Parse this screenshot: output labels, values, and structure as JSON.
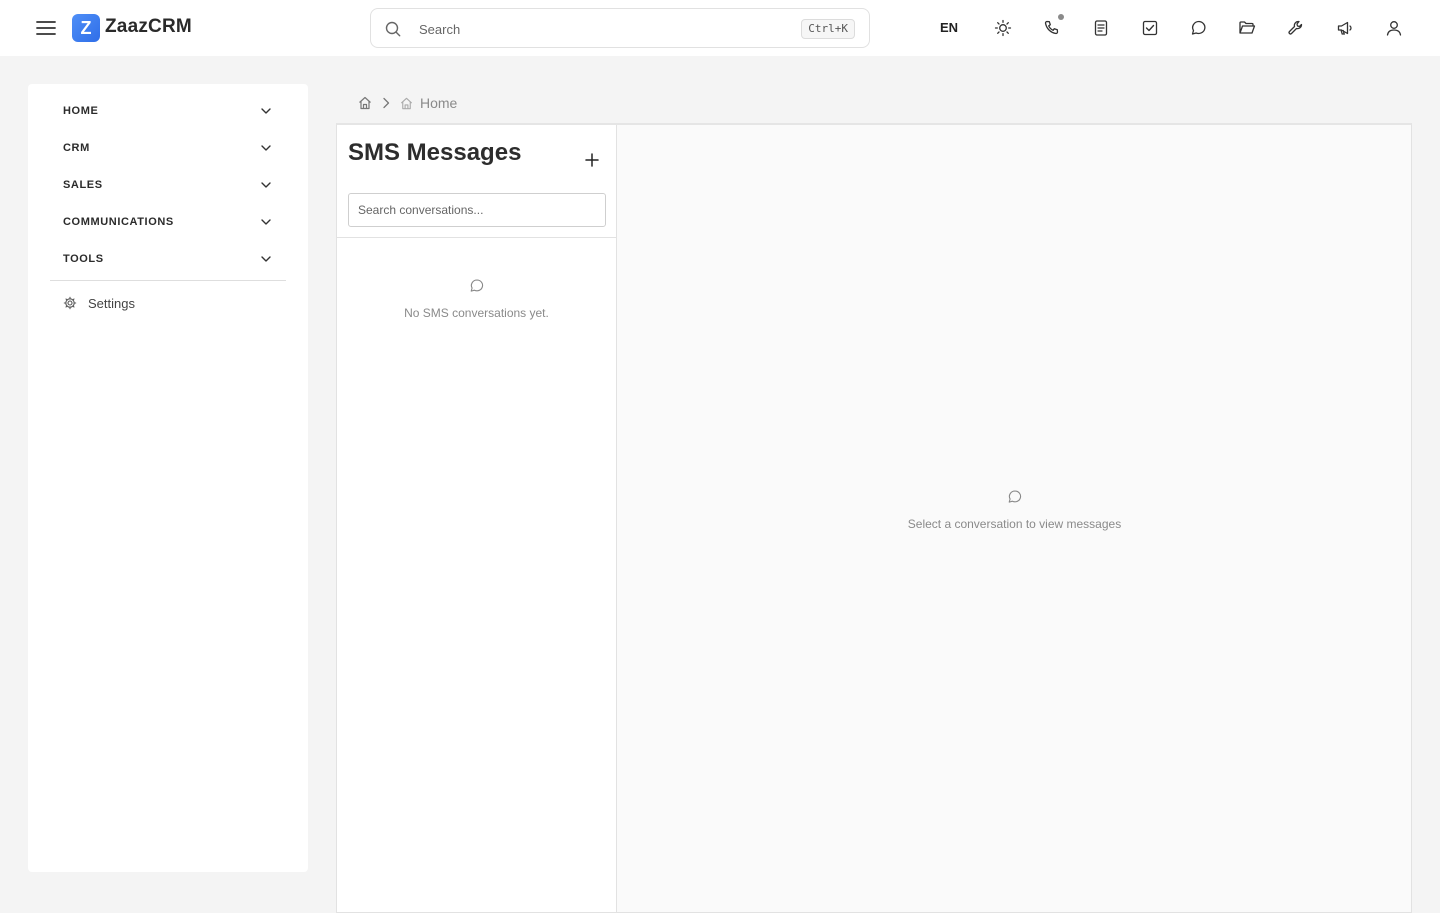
{
  "app": {
    "logo_letter": "Z",
    "name": "ZaazCRM"
  },
  "search": {
    "placeholder": "Search",
    "shortcut": "Ctrl+K"
  },
  "topbar": {
    "language": "EN",
    "icons": [
      "sun-icon",
      "phone-icon",
      "document-icon",
      "checkbox-icon",
      "chat-icon",
      "folder-icon",
      "wrench-icon",
      "megaphone-icon",
      "user-icon"
    ]
  },
  "sidebar": {
    "items": [
      {
        "label": "HOME"
      },
      {
        "label": "CRM"
      },
      {
        "label": "SALES"
      },
      {
        "label": "COMMUNICATIONS"
      },
      {
        "label": "TOOLS"
      }
    ],
    "settings_label": "Settings"
  },
  "breadcrumb": {
    "current": "Home"
  },
  "sms": {
    "title": "SMS Messages",
    "search_placeholder": "Search conversations...",
    "empty_list": "No SMS conversations yet.",
    "empty_view": "Select a conversation to view messages"
  }
}
